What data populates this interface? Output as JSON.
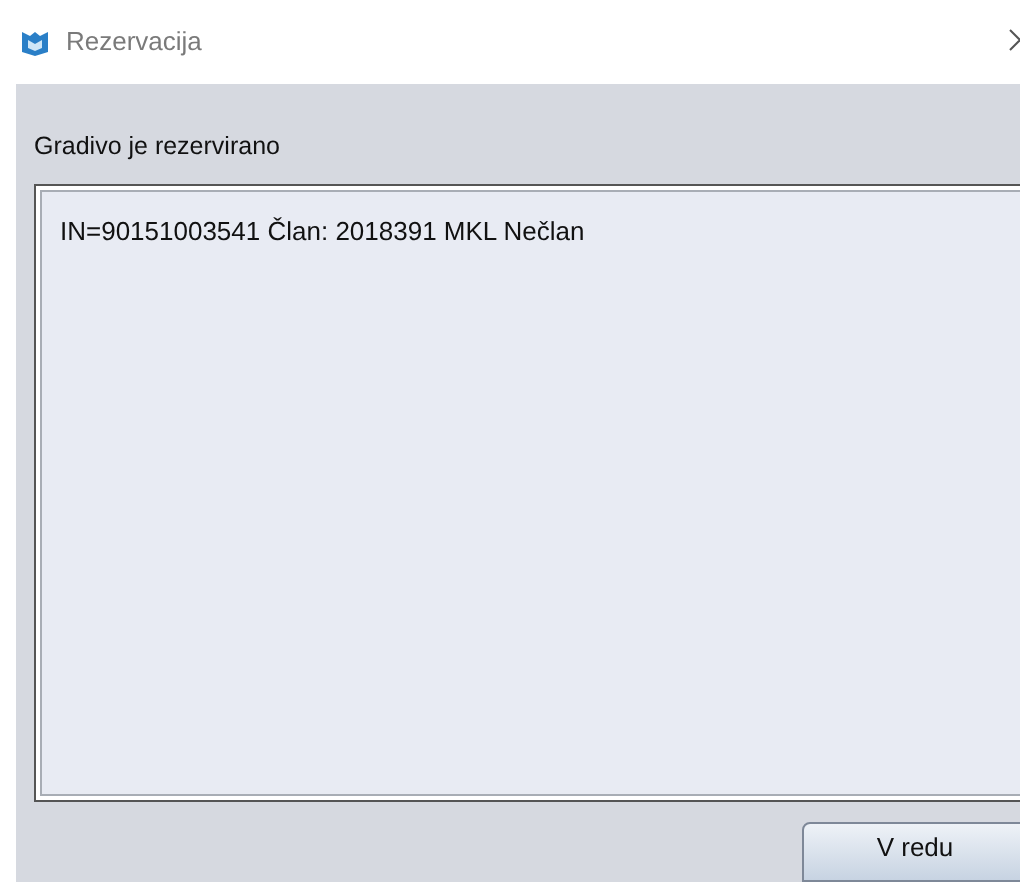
{
  "window": {
    "title": "Rezervacija"
  },
  "message": "Gradivo je rezervirano",
  "details": "IN=90151003541 Član: 2018391 MKL Nečlan",
  "buttons": [
    "V redu"
  ]
}
